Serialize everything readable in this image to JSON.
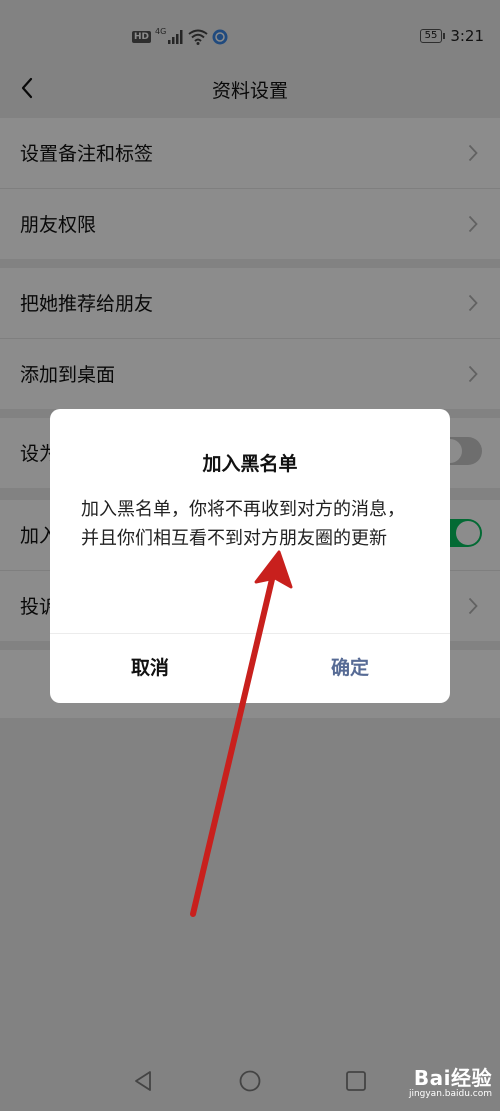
{
  "status_bar": {
    "network_badge": "HD",
    "network_type": "4G",
    "battery": "55",
    "time": "3:21"
  },
  "nav": {
    "title": "资料设置",
    "back_icon": "chevron-left-icon"
  },
  "settings": {
    "group1": [
      "设置备注和标签",
      "朋友权限"
    ],
    "group2": [
      "把她推荐给朋友",
      "添加到桌面"
    ],
    "group3_partial": "设为",
    "group4_partial": [
      "加入",
      "投诉"
    ]
  },
  "dialog": {
    "title": "加入黑名单",
    "message": "加入黑名单，你将不再收到对方的消息，并且你们相互看不到对方朋友圈的更新",
    "cancel_label": "取消",
    "confirm_label": "确定"
  },
  "colors": {
    "confirm": "#576b95",
    "toggle_on": "#07c160",
    "annotation_arrow": "#c8201d"
  },
  "watermark": {
    "logo": "Bai经验",
    "url": "jingyan.baidu.com"
  }
}
